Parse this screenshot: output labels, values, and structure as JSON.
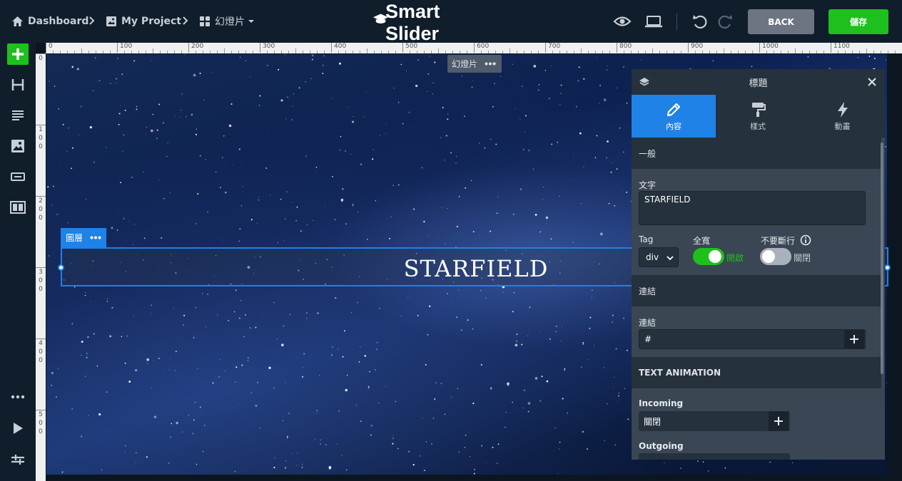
{
  "topbar": {
    "breadcrumbs": [
      "Dashboard",
      "My Project",
      "幻燈片"
    ],
    "logo": "Smart Slider",
    "back_label": "BACK",
    "save_label": "儲存"
  },
  "leftbar": {
    "items": [
      "add-icon",
      "heading-icon",
      "text-icon",
      "image-icon",
      "button-icon",
      "columns-icon",
      "more-icon",
      "play-icon",
      "structure-icon"
    ]
  },
  "ruler": {
    "top_ticks": [
      "0",
      "100",
      "200",
      "300",
      "400",
      "500",
      "600",
      "700",
      "800",
      "900",
      "1000",
      "1100"
    ],
    "left_ticks": [
      "0",
      "1\n0\n0",
      "2\n0\n0",
      "3\n0\n0",
      "4\n0\n0",
      "5\n0\n0"
    ]
  },
  "canvas": {
    "slide_label": "幻燈片",
    "layer_tag": "圖層",
    "layer_text": "STARFIELD"
  },
  "panel": {
    "title": "標題",
    "tabs": [
      "內容",
      "樣式",
      "動畫"
    ],
    "section_general": "一般",
    "text_label": "文字",
    "text_value": "STARFIELD",
    "tag_label": "Tag",
    "tag_value": "div",
    "fullwidth_label": "全寬",
    "fullwidth_state": "開啟",
    "nowrap_label": "不要斷行",
    "nowrap_state": "關閉",
    "section_link": "連結",
    "link_label": "連結",
    "link_value": "#",
    "section_anim": "TEXT ANIMATION",
    "incoming_label": "Incoming",
    "incoming_value": "關閉",
    "outgoing_label": "Outgoing"
  },
  "colors": {
    "accent": "#1e82e6",
    "save": "#1ec01e",
    "toggle_on": "#1ec01e",
    "topbar": "#101d2b",
    "panel": "#3a4653"
  }
}
